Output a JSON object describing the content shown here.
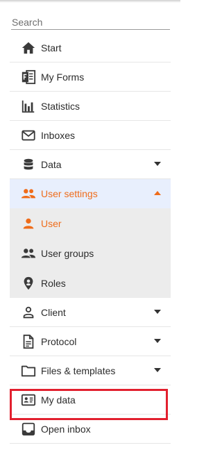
{
  "search": {
    "placeholder": "Search"
  },
  "menu": {
    "start": "Start",
    "my_forms": "My Forms",
    "statistics": "Statistics",
    "inboxes": "Inboxes",
    "data": "Data",
    "user_settings": "User settings",
    "user_settings_sub": {
      "user": "User",
      "user_groups": "User groups",
      "roles": "Roles"
    },
    "client": "Client",
    "protocol": "Protocol",
    "files_templates": "Files & templates",
    "my_data": "My data",
    "open_inbox": "Open inbox"
  },
  "colors": {
    "accent": "#ef6c1a",
    "open_bg": "#e8effd",
    "submenu_bg": "#ececec",
    "highlight_frame": "#e2202e"
  },
  "icons": {
    "start": "home-icon",
    "my_forms": "forms-icon",
    "statistics": "bar-chart-icon",
    "inboxes": "envelope-icon",
    "data": "database-icon",
    "user_settings": "people-icon",
    "user": "person-icon",
    "user_groups": "people-icon",
    "roles": "badge-icon",
    "client": "person-outline-icon",
    "protocol": "document-icon",
    "files_templates": "folder-icon",
    "my_data": "id-card-icon",
    "open_inbox": "inbox-tray-icon"
  }
}
